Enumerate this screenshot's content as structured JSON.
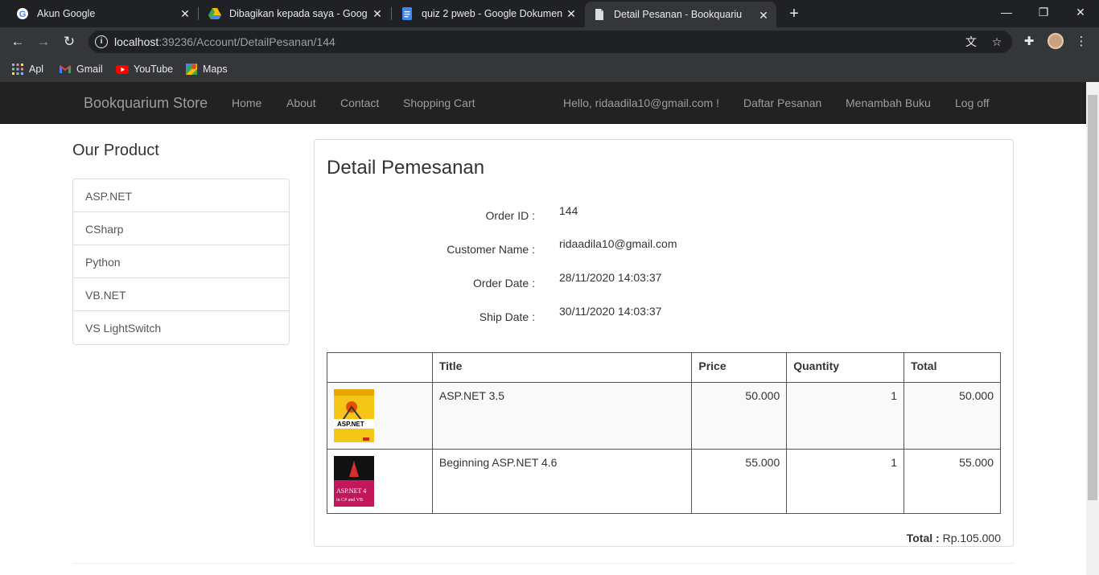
{
  "browser": {
    "tabs": [
      {
        "title": "Akun Google",
        "icon": "google-icon"
      },
      {
        "title": "Dibagikan kepada saya - Google",
        "icon": "google-drive-icon"
      },
      {
        "title": "quiz 2 pweb - Google Dokumen",
        "icon": "google-docs-icon"
      },
      {
        "title": "Detail Pesanan - Bookquarium St",
        "icon": "page-icon",
        "active": true
      }
    ],
    "url_host": "localhost",
    "url_rest": ":39236/Account/DetailPesanan/144",
    "bookmarks": [
      {
        "label": "Apl",
        "icon": "apps-grid-icon"
      },
      {
        "label": "Gmail",
        "icon": "gmail-icon"
      },
      {
        "label": "YouTube",
        "icon": "youtube-icon"
      },
      {
        "label": "Maps",
        "icon": "maps-icon"
      }
    ]
  },
  "navbar": {
    "brand": "Bookquarium Store",
    "links": [
      "Home",
      "About",
      "Contact",
      "Shopping Cart"
    ],
    "right_links": [
      "Hello, ridaadila10@gmail.com !",
      "Daftar Pesanan",
      "Menambah Buku",
      "Log off"
    ]
  },
  "sidebar": {
    "title": "Our Product",
    "items": [
      "ASP.NET",
      "CSharp",
      "Python",
      "VB.NET",
      "VS LightSwitch"
    ]
  },
  "detail": {
    "title": "Detail Pemesanan",
    "fields": [
      {
        "label": "Order ID :",
        "value": "144"
      },
      {
        "label": "Customer Name :",
        "value": "ridaadila10@gmail.com"
      },
      {
        "label": "Order Date :",
        "value": "28/11/2020 14:03:37"
      },
      {
        "label": "Ship Date :",
        "value": "30/11/2020 14:03:37"
      }
    ],
    "table": {
      "headers": [
        "",
        "Title",
        "Price",
        "Quantity",
        "Total"
      ],
      "rows": [
        {
          "title": "ASP.NET 3.5",
          "price": "50.000",
          "quantity": "1",
          "total": "50.000",
          "cover_color": "#f5c518"
        },
        {
          "title": "Beginning ASP.NET 4.6",
          "price": "55.000",
          "quantity": "1",
          "total": "55.000",
          "cover_color": "#c2185b"
        }
      ]
    },
    "total_label": "Total :",
    "total_value": " Rp.105.000"
  }
}
